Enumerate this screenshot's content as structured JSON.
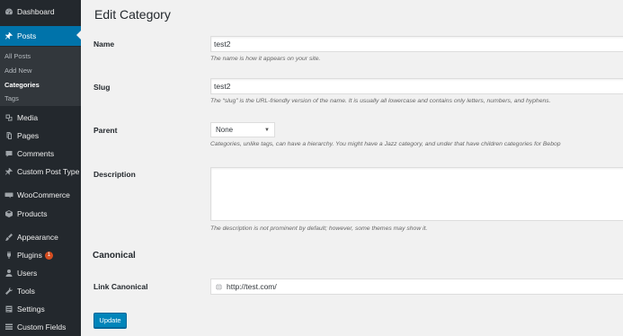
{
  "sidebar": {
    "dashboard": {
      "label": "Dashboard",
      "icon": "dashboard-icon"
    },
    "posts": {
      "label": "Posts",
      "icon": "pin-icon"
    },
    "posts_submenu": [
      "All Posts",
      "Add New",
      "Categories",
      "Tags"
    ],
    "active_submenu": "Categories",
    "items": [
      {
        "label": "Media",
        "icon": "media-icon"
      },
      {
        "label": "Pages",
        "icon": "pages-icon"
      },
      {
        "label": "Comments",
        "icon": "comments-icon"
      },
      {
        "label": "Custom Post Type",
        "icon": "pin-icon"
      },
      {
        "label": "WooCommerce",
        "icon": "woocommerce-icon"
      },
      {
        "label": "Products",
        "icon": "products-icon"
      },
      {
        "label": "Appearance",
        "icon": "appearance-icon"
      },
      {
        "label": "Plugins",
        "icon": "plugins-icon",
        "badge": "1"
      },
      {
        "label": "Users",
        "icon": "users-icon"
      },
      {
        "label": "Tools",
        "icon": "tools-icon"
      },
      {
        "label": "Settings",
        "icon": "settings-icon"
      },
      {
        "label": "Custom Fields",
        "icon": "custom-fields-icon"
      }
    ]
  },
  "page": {
    "title": "Edit Category",
    "name": {
      "label": "Name",
      "value": "test2",
      "description": "The name is how it appears on your site."
    },
    "slug": {
      "label": "Slug",
      "value": "test2",
      "description": "The “slug” is the URL-friendly version of the name. It is usually all lowercase and contains only letters, numbers, and hyphens."
    },
    "parent": {
      "label": "Parent",
      "selected": "None",
      "description": "Categories, unlike tags, can have a hierarchy. You might have a Jazz category, and under that have children categories for Bebop"
    },
    "description": {
      "label": "Description",
      "value": "",
      "description": "The description is not prominent by default; however, some themes may show it."
    },
    "canonical": {
      "section_title": "Canonical",
      "label": "Link Canonical",
      "value": "http://test.com/"
    },
    "update_button": "Update"
  },
  "colors": {
    "sidebar_bg": "#23282d",
    "accent": "#0073aa",
    "button": "#0085ba"
  }
}
